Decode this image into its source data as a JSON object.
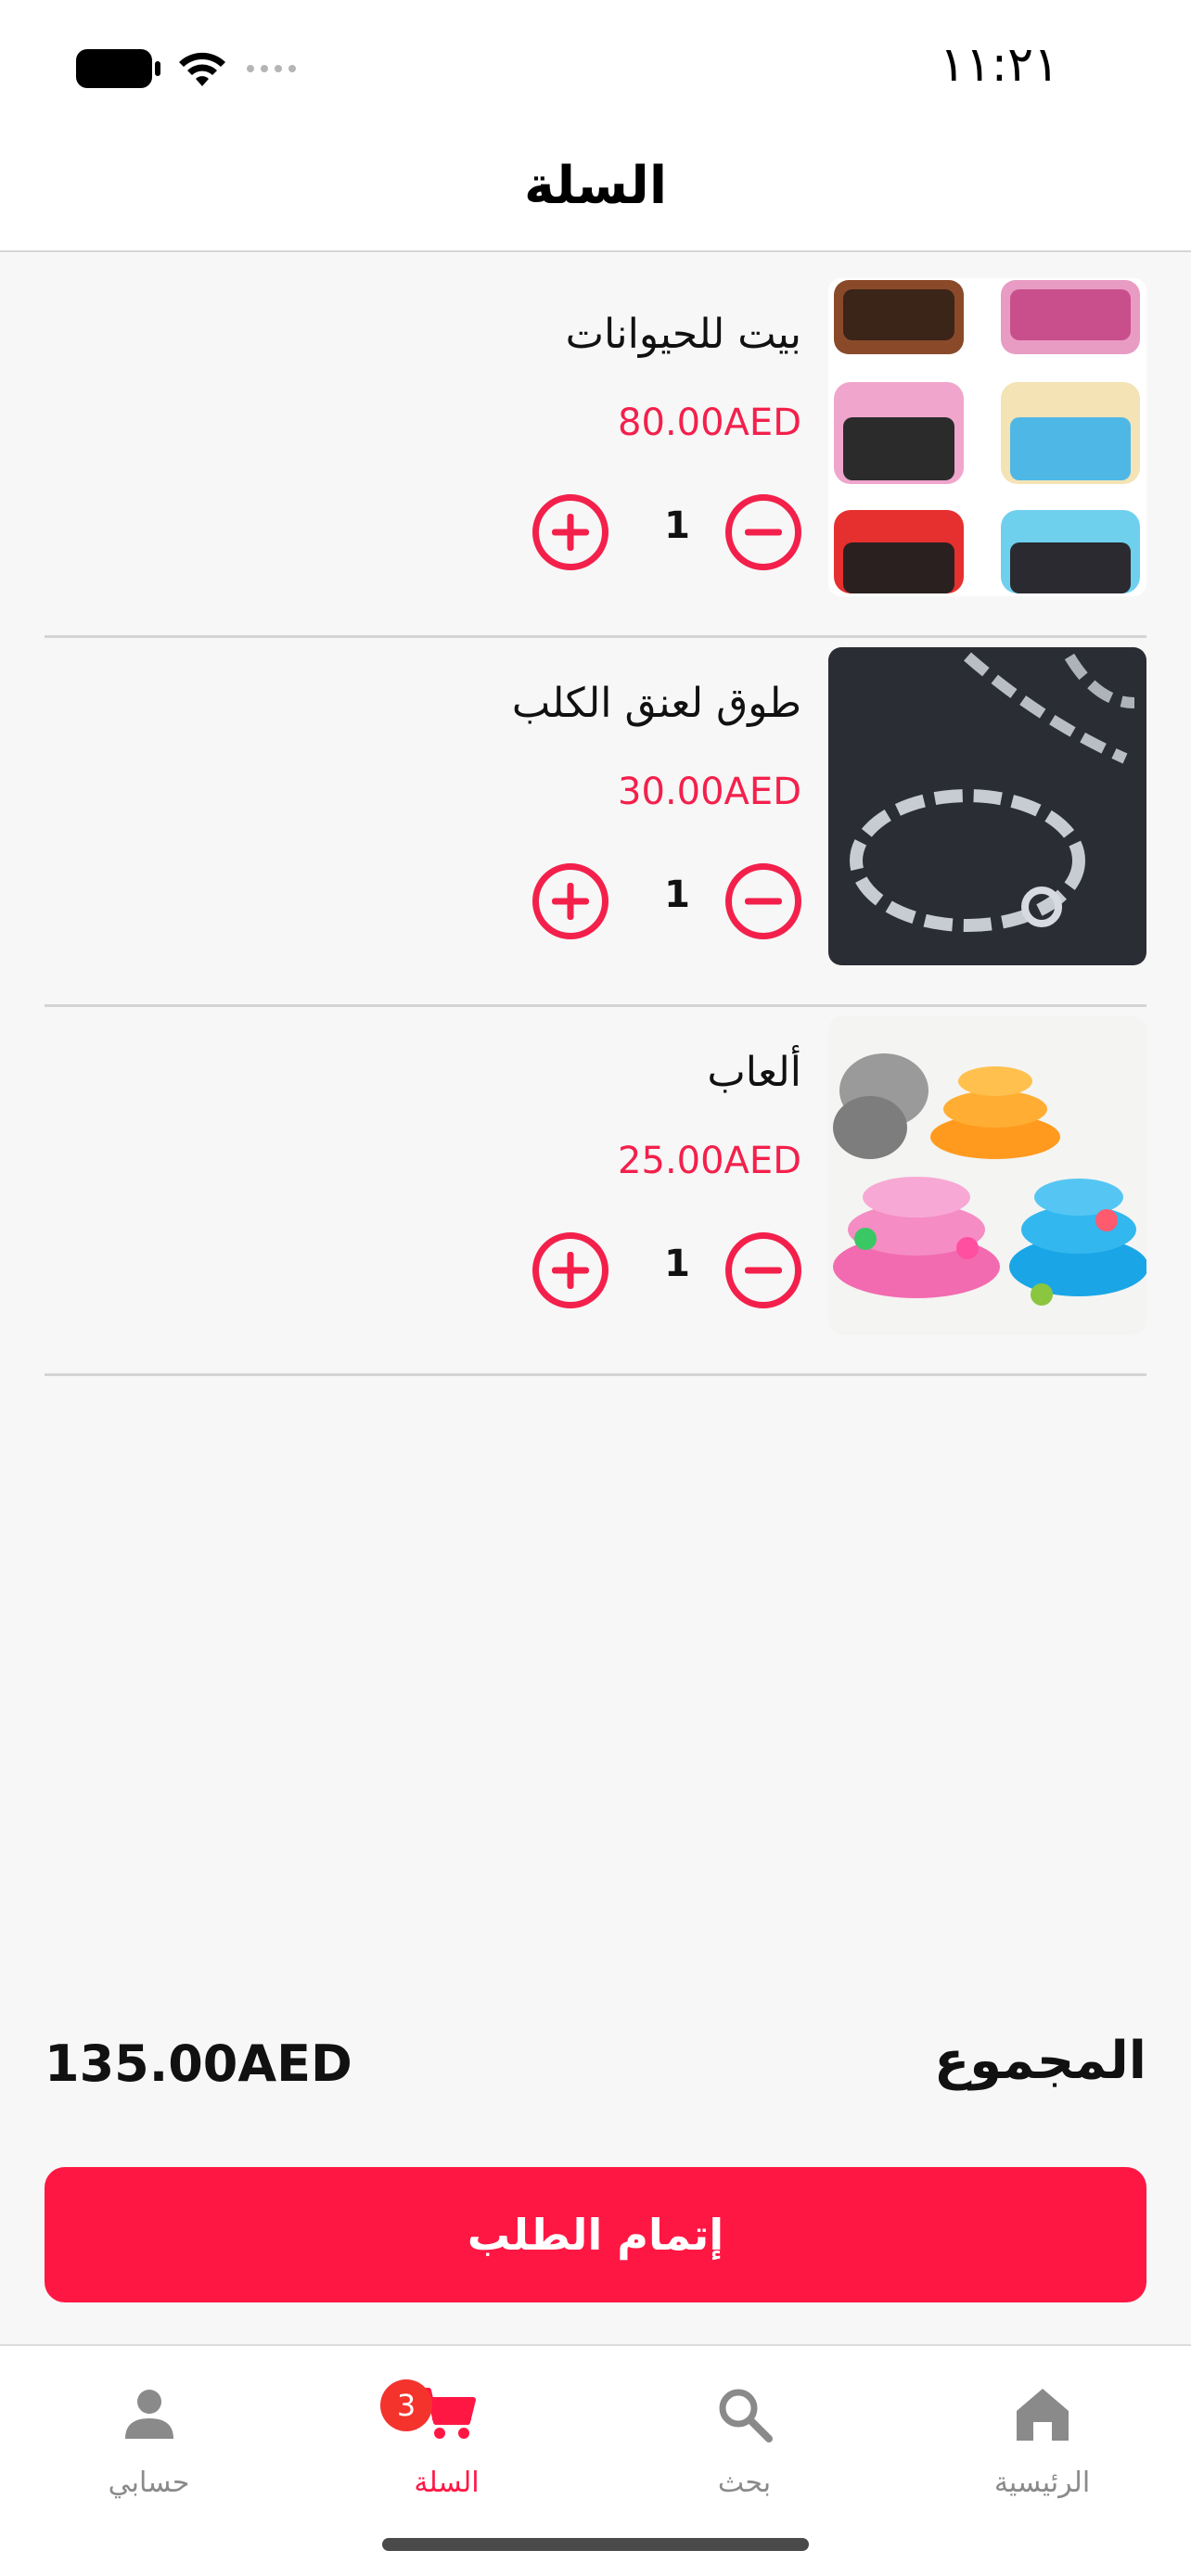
{
  "status_bar": {
    "time": "١١:٢١"
  },
  "header": {
    "title": "السلة"
  },
  "cart": {
    "items": [
      {
        "name": "بيت للحيوانات",
        "price": "80.00AED",
        "quantity": "1",
        "image": "pet-playpen-image"
      },
      {
        "name": "طوق لعنق الكلب",
        "price": "30.00AED",
        "quantity": "1",
        "image": "dog-chain-collar-image"
      },
      {
        "name": "ألعاب",
        "price": "25.00AED",
        "quantity": "1",
        "image": "cat-ball-tower-toy-image"
      }
    ]
  },
  "summary": {
    "total_label": "المجموع",
    "total_value": "135.00AED"
  },
  "checkout": {
    "label": "إتمام الطلب"
  },
  "tabs": [
    {
      "label": "حسابي",
      "icon": "person-icon",
      "active": false
    },
    {
      "label": "السلة",
      "icon": "cart-icon",
      "active": true,
      "badge": "3"
    },
    {
      "label": "بحث",
      "icon": "search-icon",
      "active": false
    },
    {
      "label": "الرئيسية",
      "icon": "home-icon",
      "active": false
    }
  ],
  "colors": {
    "accent": "#ff1744",
    "price": "#f3204b",
    "badge": "#f4332d",
    "inactive_tab": "#8a8a8a"
  }
}
